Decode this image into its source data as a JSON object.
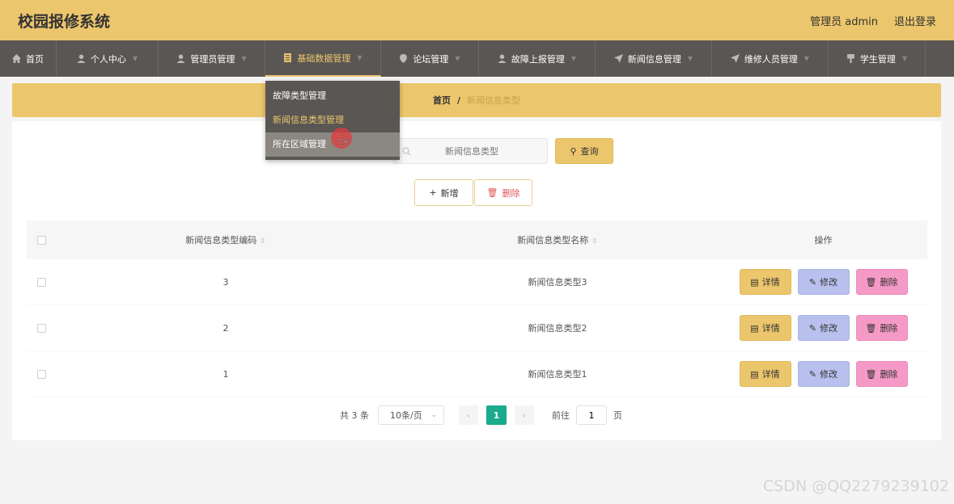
{
  "header": {
    "title": "校园报修系统",
    "user_label": "管理员 admin",
    "logout_label": "退出登录"
  },
  "nav": {
    "items": [
      {
        "label": "首页",
        "icon": "home-icon"
      },
      {
        "label": "个人中心",
        "icon": "user-icon"
      },
      {
        "label": "管理员管理",
        "icon": "user-icon"
      },
      {
        "label": "基础数据管理",
        "icon": "list-icon"
      },
      {
        "label": "论坛管理",
        "icon": "pin-icon"
      },
      {
        "label": "故障上报管理",
        "icon": "user-icon"
      },
      {
        "label": "新闻信息管理",
        "icon": "send-icon"
      },
      {
        "label": "维修人员管理",
        "icon": "send-icon"
      },
      {
        "label": "学生管理",
        "icon": "flag-icon"
      }
    ]
  },
  "dropdown": {
    "items": [
      "故障类型管理",
      "新闻信息类型管理",
      "所在区域管理"
    ]
  },
  "breadcrumb": {
    "home": "首页",
    "separator": "/",
    "current": "新闻信息类型"
  },
  "search": {
    "placeholder": "新闻信息类型",
    "button": "查询"
  },
  "actions": {
    "add": "新增",
    "delete": "删除"
  },
  "table": {
    "columns": [
      "新闻信息类型编码",
      "新闻信息类型名称",
      "操作"
    ],
    "rows": [
      {
        "code": "3",
        "name": "新闻信息类型3"
      },
      {
        "code": "2",
        "name": "新闻信息类型2"
      },
      {
        "code": "1",
        "name": "新闻信息类型1"
      }
    ],
    "op_labels": {
      "detail": "详情",
      "edit": "修改",
      "delete": "删除"
    }
  },
  "pagination": {
    "total": "共 3 条",
    "page_size": "10条/页",
    "current_page": "1",
    "goto_prefix": "前往",
    "goto_value": "1",
    "goto_suffix": "页"
  },
  "watermark": "CSDN @QQ2279239102",
  "colors": {
    "accent": "#ecc66c",
    "nav_bg": "#5a5653",
    "page_active": "#1aaa8c",
    "edit": "#b9c0ee",
    "delete": "#f59ac6"
  }
}
